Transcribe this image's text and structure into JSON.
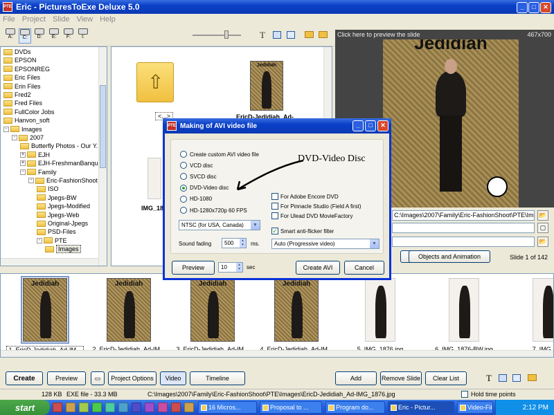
{
  "window": {
    "title": "Eric - PicturesToExe Deluxe 5.0",
    "menu": [
      "File",
      "Project",
      "Slide",
      "View",
      "Help"
    ]
  },
  "drives": [
    "A:",
    "C:",
    "D:",
    "E:",
    "F:",
    "I:"
  ],
  "tree": [
    {
      "label": "DVDs",
      "indent": 0,
      "expand": ""
    },
    {
      "label": "EPSON",
      "indent": 0,
      "expand": ""
    },
    {
      "label": "EPSONREG",
      "indent": 0,
      "expand": ""
    },
    {
      "label": "Eric Files",
      "indent": 0,
      "expand": ""
    },
    {
      "label": "Erin Files",
      "indent": 0,
      "expand": ""
    },
    {
      "label": "Fred2",
      "indent": 0,
      "expand": ""
    },
    {
      "label": "Fred Files",
      "indent": 0,
      "expand": ""
    },
    {
      "label": "FullColor Jobs",
      "indent": 0,
      "expand": ""
    },
    {
      "label": "Hanvon_soft",
      "indent": 0,
      "expand": ""
    },
    {
      "label": "Images",
      "indent": 0,
      "expand": "-"
    },
    {
      "label": "2007",
      "indent": 1,
      "expand": "-"
    },
    {
      "label": "Butterfly Photos - Our Y...",
      "indent": 2,
      "expand": ""
    },
    {
      "label": "EJH",
      "indent": 2,
      "expand": "+"
    },
    {
      "label": "EJH-FreshmanBanquet",
      "indent": 2,
      "expand": "+"
    },
    {
      "label": "Family",
      "indent": 2,
      "expand": "-"
    },
    {
      "label": "Eric-FashionShoot",
      "indent": 3,
      "expand": "-"
    },
    {
      "label": "ISO",
      "indent": 4,
      "expand": ""
    },
    {
      "label": "Jpegs-BW",
      "indent": 4,
      "expand": ""
    },
    {
      "label": "Jpegs-Modified",
      "indent": 4,
      "expand": ""
    },
    {
      "label": "Jpegs-Web",
      "indent": 4,
      "expand": ""
    },
    {
      "label": "Original-Jpegs",
      "indent": 4,
      "expand": ""
    },
    {
      "label": "PSD-Files",
      "indent": 4,
      "expand": ""
    },
    {
      "label": "PTE",
      "indent": 4,
      "expand": "-"
    },
    {
      "label": "Images",
      "indent": 5,
      "expand": "",
      "selected": true
    }
  ],
  "filelist": {
    "up_label": "<...>",
    "file1": "EricD-Jedidiah_Ad-",
    "file2": "IMG_18"
  },
  "preview": {
    "hint": "Click here to preview the slide",
    "size": "467x700",
    "title": "Jedidiah",
    "path1": "C:\\Images\\2007\\Family\\Eric-FashionShoot\\PTE\\Images\\",
    "objects_button": "Objects and Animation",
    "slide_counter": "Slide 1 of 142"
  },
  "strip": [
    {
      "caption": "1. EricD-Jedidiah_Ad-IM...",
      "kind": "ad"
    },
    {
      "caption": "2. EricD-Jedidiah_Ad-IM...",
      "kind": "ad"
    },
    {
      "caption": "3. EricD-Jedidiah_Ad-IM...",
      "kind": "ad"
    },
    {
      "caption": "4. EricD-Jedidiah_Ad-IM...",
      "kind": "ad"
    },
    {
      "caption": "5. IMG_1876.jpg",
      "kind": "photo"
    },
    {
      "caption": "6. IMG_1876-BW.jpg",
      "kind": "photo"
    },
    {
      "caption": "7. IMG_1...",
      "kind": "photo"
    }
  ],
  "strip_title": "Jedidiah",
  "bottom": {
    "create": "Create",
    "preview": "Preview",
    "project_options": "Project Options",
    "video": "Video",
    "timeline": "Timeline",
    "add": "Add",
    "remove_slide": "Remove Slide",
    "clear_list": "Clear List",
    "hold_time_points": "Hold time points"
  },
  "status": {
    "size": "128 KB",
    "exe": "EXE file - 33.3 MB",
    "path": "C:\\Images\\2007\\Family\\Eric-FashionShoot\\PTE\\Images\\EricD-Jedidiah_Ad-IMG_1876.jpg"
  },
  "taskbar": {
    "start": "start",
    "items": [
      "16 Micros...",
      "Proposal to ...",
      "Program do...",
      "Eric - Pictur...",
      "Video-Files"
    ],
    "clock": "2:12 PM"
  },
  "dialog": {
    "title": "Making of AVI video file",
    "radios": [
      {
        "label": "Create custom AVI video file",
        "checked": false
      },
      {
        "label": "VCD disc",
        "checked": false
      },
      {
        "label": "SVCD disc",
        "checked": false
      },
      {
        "label": "DVD-Video disc",
        "checked": true
      },
      {
        "label": "HD-1080",
        "checked": false
      },
      {
        "label": "HD-1280x720p 60 FPS",
        "checked": false
      }
    ],
    "checks": [
      {
        "label": "For Adobe Encore DVD",
        "checked": false
      },
      {
        "label": "For Pinnacle Studio (Field A first)",
        "checked": false
      },
      {
        "label": "For Ulead DVD MovieFactory",
        "checked": false
      },
      {
        "label": "Smart anti-flicker filter",
        "checked": true
      }
    ],
    "standard": "NTSC (for USA, Canada)",
    "sound_fading_label": "Sound fading",
    "sound_fading_value": "500",
    "sound_fading_unit": "ms.",
    "filter_mode": "Auto (Progressive video)",
    "preview_button": "Preview",
    "sec_value": "10",
    "sec_label": "sec",
    "create_button": "Create AVI",
    "cancel_button": "Cancel",
    "annotation": "DVD-Video Disc"
  }
}
